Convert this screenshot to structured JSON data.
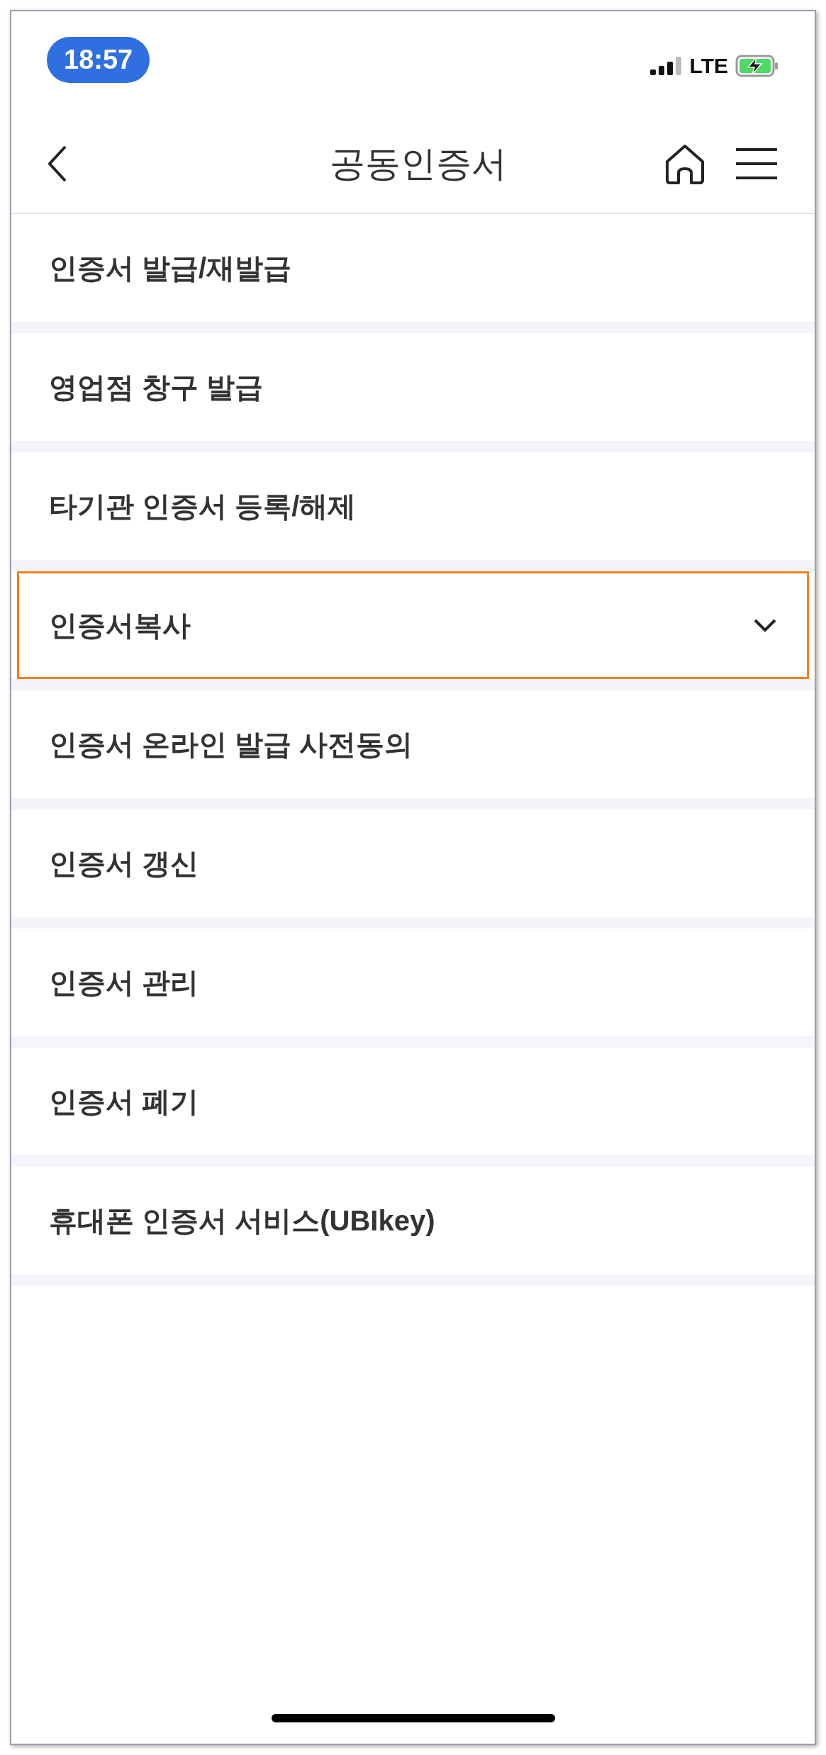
{
  "status_bar": {
    "time": "18:57",
    "network": "LTE"
  },
  "nav": {
    "title": "공동인증서"
  },
  "items": [
    {
      "label": "인증서 발급/재발급",
      "kind": "link",
      "highlighted": false
    },
    {
      "label": "영업점 창구 발급",
      "kind": "link",
      "highlighted": false
    },
    {
      "label": "타기관 인증서 등록/해제",
      "kind": "link",
      "highlighted": false
    },
    {
      "label": "인증서복사",
      "kind": "dropdown",
      "highlighted": true
    },
    {
      "label": "인증서 온라인 발급 사전동의",
      "kind": "link",
      "highlighted": false
    },
    {
      "label": "인증서 갱신",
      "kind": "link",
      "highlighted": false
    },
    {
      "label": "인증서 관리",
      "kind": "link",
      "highlighted": false
    },
    {
      "label": "인증서 폐기",
      "kind": "link",
      "highlighted": false
    },
    {
      "label": "휴대폰 인증서 서비스(UBIkey)",
      "kind": "link",
      "highlighted": false
    }
  ]
}
